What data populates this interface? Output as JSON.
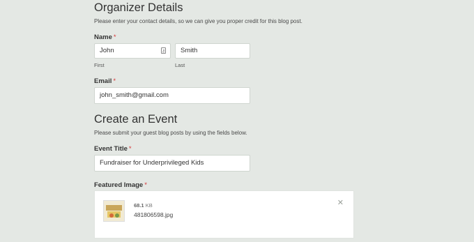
{
  "organizer": {
    "title": "Organizer Details",
    "description": "Please enter your contact details, so we can give you proper credit for this blog post.",
    "name_label": "Name",
    "required_mark": "*",
    "first_value": "John",
    "first_sublabel": "First",
    "last_value": "Smith",
    "last_sublabel": "Last",
    "email_label": "Email",
    "email_value": "john_smith@gmail.com"
  },
  "event": {
    "title": "Create an Event",
    "description": "Please submit your guest blog posts by using the fields below.",
    "event_title_label": "Event Title",
    "event_title_value": "Fundraiser for Underprivileged Kids",
    "featured_image_label": "Featured Image",
    "file_size_value": "68.1",
    "file_size_unit": "KB",
    "file_name": "481806598.jpg"
  },
  "icons": {
    "contact_card": "contact-card-icon",
    "remove": "close-icon",
    "remove_glyph": "✕"
  },
  "colors": {
    "background": "#e4e8e4",
    "required": "#d63637"
  }
}
